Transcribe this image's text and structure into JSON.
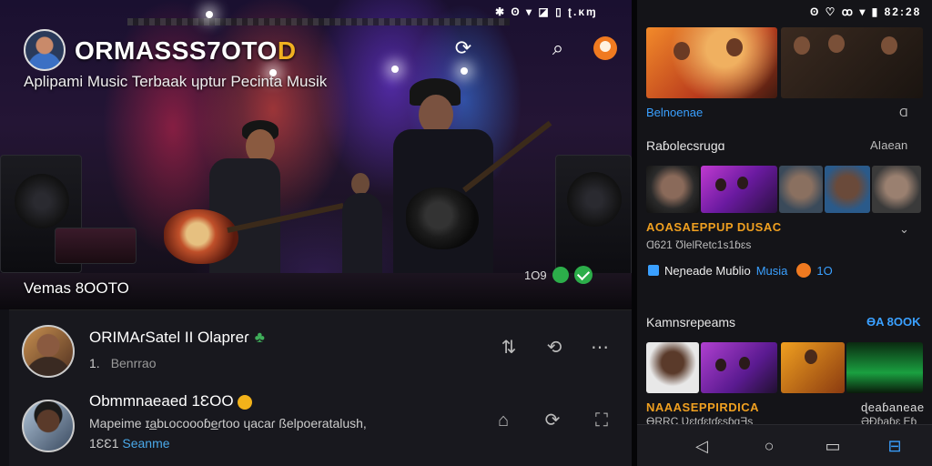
{
  "app": {
    "brand_main": "ORMASSS7OTO",
    "brand_accent": "D",
    "tagline": "Aplipami Music Terbaak ɥptur Pecinta Musik",
    "status_left": "✱ ʘ ▾ ◪ ▯ ʈ.ᴋɱ",
    "status_right": "ʘ ♡ ꝏ ▾ ▮ 82:28"
  },
  "icons": {
    "refresh": "refresh-icon",
    "search": "search-icon",
    "profile": "profile-icon"
  },
  "hero": {
    "label": "Vemas 8OOTO",
    "meta": "1O9"
  },
  "list": [
    {
      "title": "ORIMAɾSatel II Olapreɾ",
      "line1_num": "1.",
      "line1_text": "Benrrao"
    },
    {
      "title": "Obmmnaeaed 1ƐOO",
      "line1_text": "Mapeime ɪa̲bʟocoooɓe̲ɾtoo ɥacaɾ ßelpoeratalush,",
      "line2_num": "1ƐƐ1",
      "line2_text": "Seanme"
    }
  ],
  "right": {
    "top_link": "Belnoenae",
    "top_chev": "Ɑ",
    "section1_title": "Raɓolecsrugɑ",
    "section1_link": "AIaean",
    "section1_caption": "AOASAEPPUP DUSAC",
    "section1_sub": "Ɑ621  ƱlelRetc1s1ɓɛs",
    "info_label": "Neɲeade Muɓlio",
    "info_blue": "Musia",
    "info_num": "1O",
    "section2_title": "Kamnsrepeams",
    "section2_link": "ƟA 8OOK",
    "section2_caption": "NAAASEPPIRDICA",
    "section2_sub": "ƟRRC  ƲɛtɗɛtɗɛsɓɑƎs",
    "section2_right_a": "ɖeaɓaneae",
    "section2_right_b": "ƏĐɓaɓɛ Eɓ"
  },
  "colors": {
    "accent_orange": "#f0b020",
    "accent_blue": "#3aa0ff",
    "accent_green": "#2cae4a"
  }
}
